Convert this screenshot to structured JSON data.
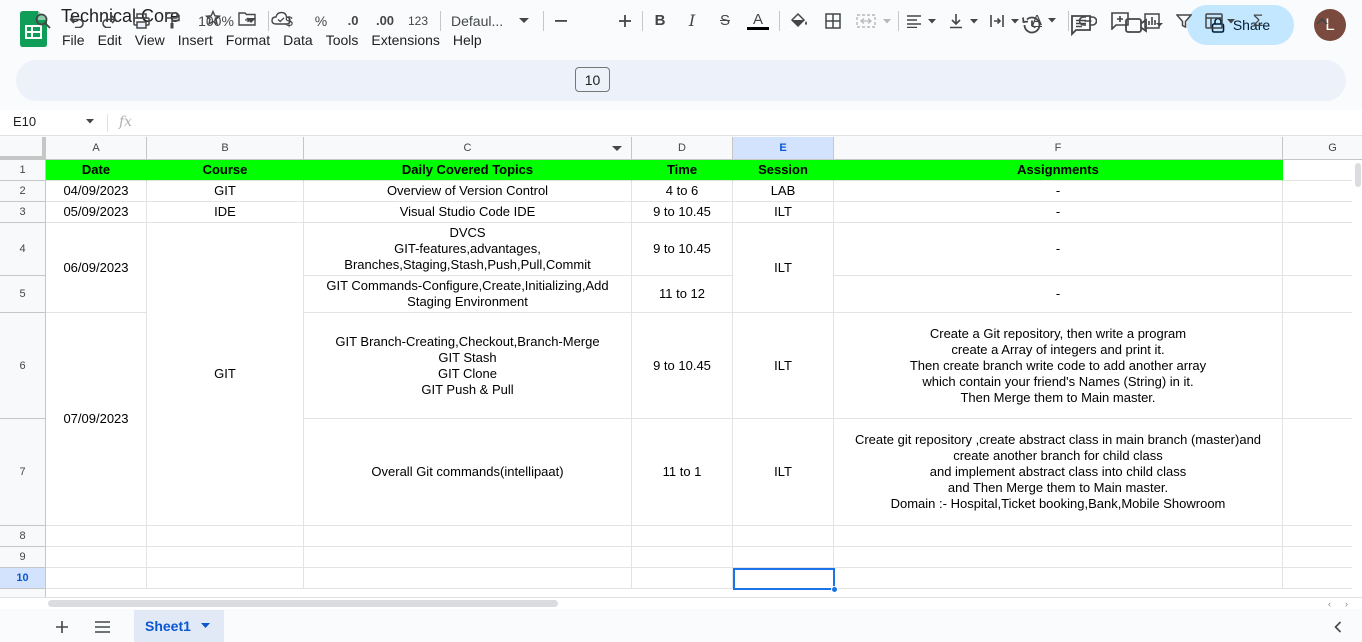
{
  "app": {
    "doc_title": "Technical Core",
    "menus": [
      "File",
      "Edit",
      "View",
      "Insert",
      "Format",
      "Data",
      "Tools",
      "Extensions",
      "Help"
    ],
    "share_label": "Share",
    "avatar_letter": "L",
    "brand_color": "#0f9d58",
    "accent_color": "#0b57d0"
  },
  "toolbar": {
    "zoom": "100%",
    "currency": "$",
    "percent": "%",
    "dec_decrease": ".0",
    "dec_increase": ".00",
    "number_format": "123",
    "font": "Defaul...",
    "font_size": "10",
    "bold": "B",
    "italic": "I",
    "strike": "S",
    "text_color": "A",
    "text_rotate": "A",
    "function": "Σ"
  },
  "formula_bar": {
    "name_box": "E10",
    "fx": "fx"
  },
  "columns": [
    "A",
    "B",
    "C",
    "D",
    "E",
    "F",
    "G"
  ],
  "rows": [
    "1",
    "2",
    "3",
    "4",
    "5",
    "6",
    "7",
    "8",
    "9",
    "10"
  ],
  "header_fill": "#00ff00",
  "cells": {
    "A1": "Date",
    "B1": "Course",
    "C1": "Daily Covered Topics",
    "D1": "Time",
    "E1": "Session",
    "F1": "Assignments",
    "A2": "04/09/2023",
    "B2": "GIT",
    "C2": "Overview of Version Control",
    "D2": "4 to 6",
    "E2": "LAB",
    "F2": "-",
    "A3": "05/09/2023",
    "B3": "IDE",
    "C3": "Visual Studio Code IDE",
    "D3": "9 to 10.45",
    "E3": "ILT",
    "F3": "-",
    "A4": "06/09/2023",
    "B4": "GIT",
    "C4": "DVCS\nGIT-features,advantages,\nBranches,Staging,Stash,Push,Pull,Commit",
    "D4": "9 to 10.45",
    "E4": "ILT",
    "F4": "-",
    "C5": "GIT Commands-Configure,Create,Initializing,Add\nStaging Environment",
    "D5": "11 to 12",
    "F5": "-",
    "A6": "07/09/2023",
    "C6": "GIT Branch-Creating,Checkout,Branch-Merge\nGIT Stash\nGIT Clone\nGIT Push & Pull",
    "D6": "9 to 10.45",
    "E6": "ILT",
    "F6": "Create a Git repository, then write a program\ncreate a Array of integers and print it.\nThen create branch write code to add another array\nwhich contain your friend's Names (String) in it.\nThen Merge them to Main master.",
    "C7": "Overall Git commands(intellipaat)",
    "D7": "11 to 1",
    "E7": "ILT",
    "F7": "Create git repository ,create abstract class in main branch (master)and\ncreate another branch for child class\nand implement abstract class into child class\nand Then Merge them to Main master.\nDomain :- Hospital,Ticket booking,Bank,Mobile Showroom"
  },
  "sheet_tab": "Sheet1"
}
